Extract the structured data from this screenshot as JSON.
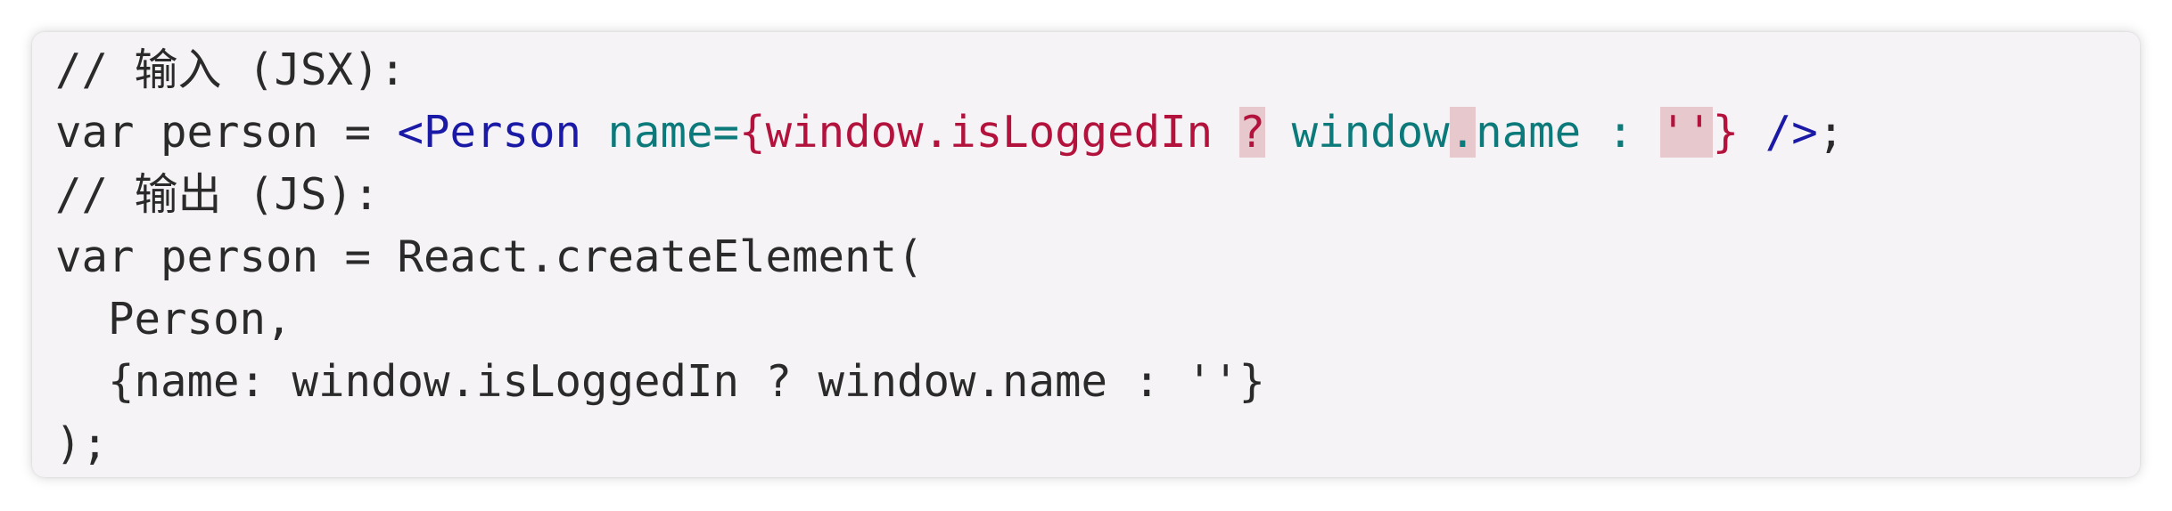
{
  "code": {
    "line1": "// 输入 (JSX):",
    "line2": {
      "var_decl": "var person = ",
      "open_tag": "<Person ",
      "attr_name": "name=",
      "brace_open": "{",
      "expr1": "window.isLoggedIn ",
      "q_mark": "?",
      "space1": " ",
      "window2": "window",
      "dot": ".",
      "name2": "name : ",
      "quotes": "''",
      "brace_close": "}",
      "self_close": " />",
      "semicolon": ";"
    },
    "line3": "// 输出 (JS):",
    "line4": "var person = React.createElement(",
    "line5": "  Person,",
    "line6": "  {name: window.isLoggedIn ? window.name : ''}",
    "line7": ");"
  },
  "colors": {
    "background": "#f6f3f6",
    "jsx_tag": "#1a1aa6",
    "jsx_attr": "#0c7a7a",
    "jsx_expr": "#b3123c",
    "highlight": "#e7c9cd"
  }
}
